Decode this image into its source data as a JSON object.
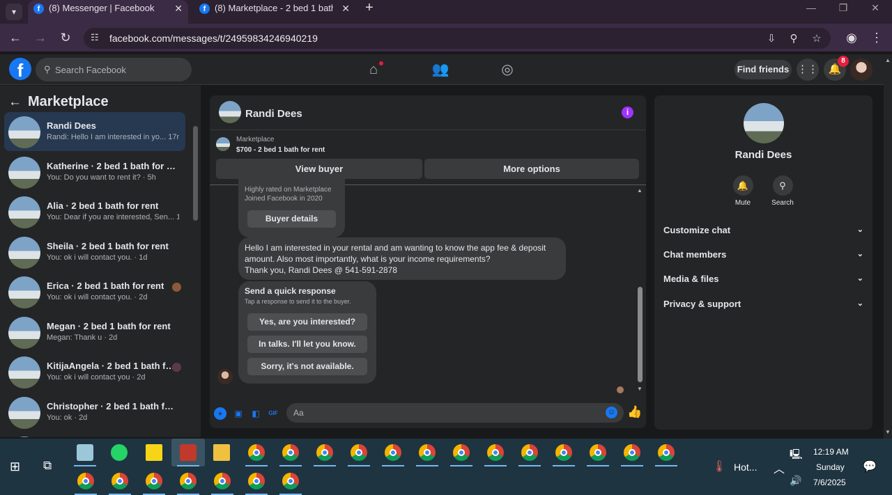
{
  "browser": {
    "tabs": [
      {
        "title": "(8) Messenger | Facebook",
        "active": true
      },
      {
        "title": "(8) Marketplace - 2 bed 1 bath f",
        "active": false
      }
    ],
    "url": "facebook.com/messages/t/24959834246940219"
  },
  "fb": {
    "search_placeholder": "Search Facebook",
    "find_friends": "Find friends",
    "notification_count": "8"
  },
  "sidebar": {
    "title": "Marketplace",
    "conversations": [
      {
        "name": "Randi Dees",
        "preview": "Randi: Hello I am interested in yo... 17m",
        "active": true
      },
      {
        "name": "Katherine · 2 bed 1 bath for rent",
        "preview": "You: Do you want to rent it? · 5h"
      },
      {
        "name": "Alia · 2 bed 1 bath for rent",
        "preview": "You: Dear if you are interested, Sen... 1d"
      },
      {
        "name": "Sheila · 2 bed 1 bath for rent",
        "preview": "You: ok i will contact you. · 1d"
      },
      {
        "name": "Erica · 2 bed 1 bath for rent",
        "preview": "You: ok i will contact you. · 2d"
      },
      {
        "name": "Megan · 2 bed 1 bath for rent",
        "preview": "Megan: Thank u · 2d"
      },
      {
        "name": "KitijaAngela · 2 bed 1 bath for...",
        "preview": "You: ok i will contact you · 2d"
      },
      {
        "name": "Christopher · 2 bed 1 bath for re...",
        "preview": "You: ok · 2d"
      }
    ]
  },
  "chat": {
    "contact_name": "Randi Dees",
    "marketplace_label": "Marketplace",
    "listing": "$700 - 2 bed 1 bath for rent",
    "view_buyer": "View buyer",
    "more_options": "More options",
    "buyer_card": {
      "line1": "Highly rated on Marketplace",
      "line2": "Joined Facebook in 2020",
      "button": "Buyer details"
    },
    "message": {
      "line1": "Hello I am interested in your rental and am wanting to know the app fee & deposit",
      "line2": "amount. Also most importantly, what is your income requirements?",
      "line3": "Thank you, Randi Dees @ 541-591-2878"
    },
    "quick_response": {
      "title": "Send a quick response",
      "subtitle": "Tap a response to send it to the buyer.",
      "options": [
        "Yes, are you interested?",
        "In talks. I'll let you know.",
        "Sorry, it's not available."
      ]
    },
    "composer_placeholder": "Aa"
  },
  "details": {
    "name": "Randi Dees",
    "mute": "Mute",
    "search": "Search",
    "sections": [
      "Customize chat",
      "Chat members",
      "Media & files",
      "Privacy & support"
    ]
  },
  "taskbar": {
    "weather": "Hot...",
    "time": "12:19 AM",
    "day": "Sunday",
    "date": "7/6/2025"
  }
}
